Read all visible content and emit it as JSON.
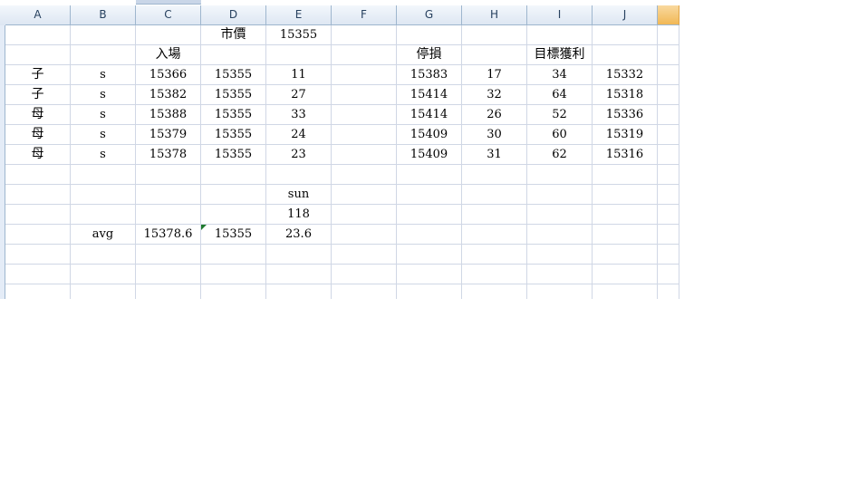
{
  "columns": [
    "A",
    "B",
    "C",
    "D",
    "E",
    "F",
    "G",
    "H",
    "I",
    "J"
  ],
  "rows": [
    [
      "",
      "",
      "",
      "市價",
      "15355",
      "",
      "",
      "",
      "",
      ""
    ],
    [
      "",
      "",
      "入場",
      "",
      "",
      "",
      "停損",
      "",
      "目標獲利",
      ""
    ],
    [
      "子",
      "s",
      "15366",
      "15355",
      "11",
      "",
      "15383",
      "17",
      "34",
      "15332"
    ],
    [
      "子",
      "s",
      "15382",
      "15355",
      "27",
      "",
      "15414",
      "32",
      "64",
      "15318"
    ],
    [
      "母",
      "s",
      "15388",
      "15355",
      "33",
      "",
      "15414",
      "26",
      "52",
      "15336"
    ],
    [
      "母",
      "s",
      "15379",
      "15355",
      "24",
      "",
      "15409",
      "30",
      "60",
      "15319"
    ],
    [
      "母",
      "s",
      "15378",
      "15355",
      "23",
      "",
      "15409",
      "31",
      "62",
      "15316"
    ],
    [
      "",
      "",
      "",
      "",
      "",
      "",
      "",
      "",
      "",
      ""
    ],
    [
      "",
      "",
      "",
      "",
      "sun",
      "",
      "",
      "",
      "",
      ""
    ],
    [
      "",
      "",
      "",
      "",
      "118",
      "",
      "",
      "",
      "",
      ""
    ],
    [
      "",
      "avg",
      "15378.6",
      "15355",
      "23.6",
      "",
      "",
      "",
      "",
      ""
    ],
    [
      "",
      "",
      "",
      "",
      "",
      "",
      "",
      "",
      "",
      ""
    ],
    [
      "",
      "",
      "",
      "",
      "",
      "",
      "",
      "",
      "",
      ""
    ],
    [
      "",
      "",
      "",
      "",
      "",
      "",
      "",
      "",
      "",
      ""
    ]
  ],
  "colors": {
    "gridline": "#d0d7e5",
    "header_bg": "#dde6f2",
    "header_text": "#27415f",
    "active_header": "#f1b855",
    "error_marker": "#1f7a2e"
  }
}
